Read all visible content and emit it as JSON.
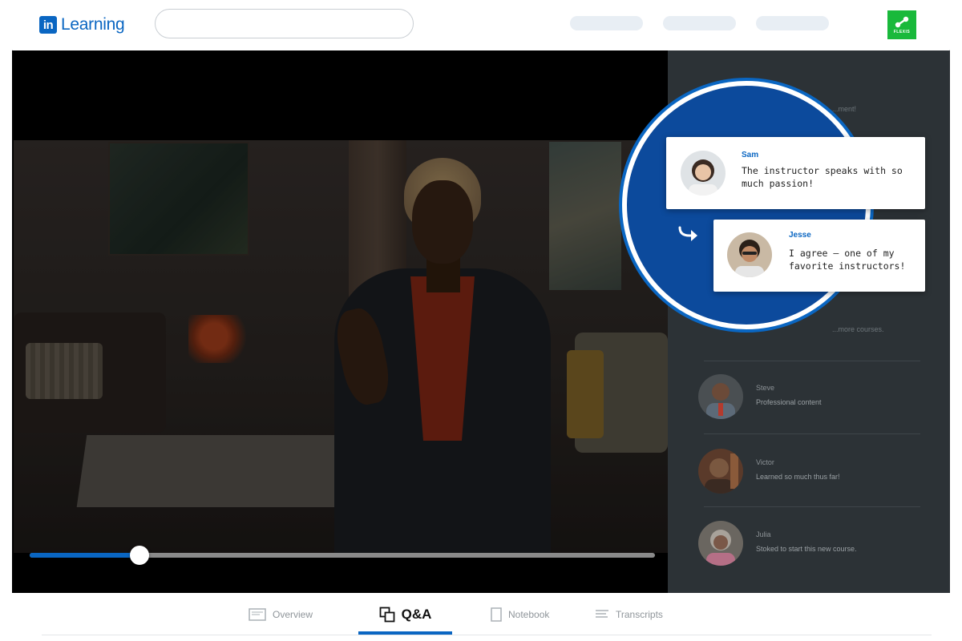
{
  "brand": {
    "logo_mark": "in",
    "logo_text": "Learning",
    "partner_label": "FLEXIS",
    "accent": "#0a66c2",
    "partner_color": "#19b93b"
  },
  "header": {
    "search_placeholder": ""
  },
  "player": {
    "progress": 0.175
  },
  "comments_panel": {
    "ghost_lines": [
      "...ment!",
      "...more courses."
    ],
    "items": [
      {
        "name": "Steve",
        "text": "Professional content"
      },
      {
        "name": "Victor",
        "text": "Learned so much thus far!"
      },
      {
        "name": "Julia",
        "text": "Stoked to start this new course."
      }
    ]
  },
  "highlight": {
    "comment": {
      "name": "Sam",
      "text": "The instructor speaks with so much passion!"
    },
    "reply": {
      "name": "Jesse",
      "text": "I agree – one of my favorite instructors!"
    }
  },
  "tabs": [
    {
      "label": "Overview",
      "icon": "overview-icon",
      "active": false
    },
    {
      "label": "Q&A",
      "icon": "qa-icon",
      "active": true
    },
    {
      "label": "Notebook",
      "icon": "notebook-icon",
      "active": false
    },
    {
      "label": "Transcripts",
      "icon": "transcripts-icon",
      "active": false
    }
  ]
}
